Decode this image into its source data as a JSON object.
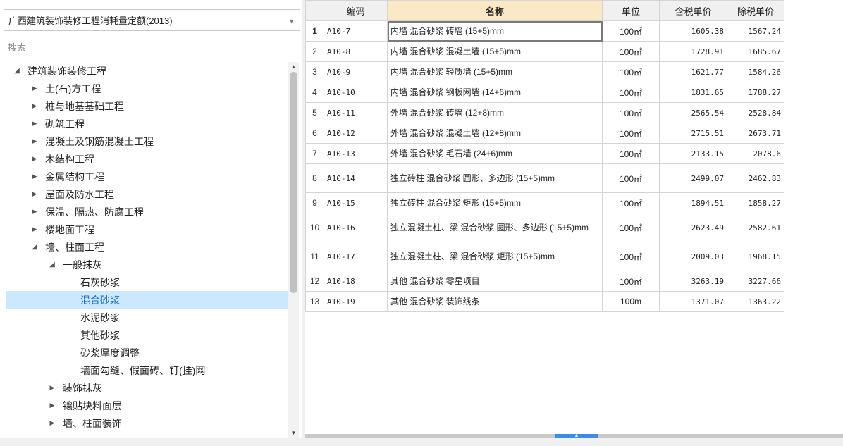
{
  "quota_select": {
    "value": "广西建筑装饰装修工程消耗量定额(2013)"
  },
  "search": {
    "placeholder": "搜索",
    "value": ""
  },
  "tree": [
    {
      "label": "建筑装饰装修工程",
      "level": 0,
      "state": "open"
    },
    {
      "label": "土(石)方工程",
      "level": 1,
      "state": "closed"
    },
    {
      "label": "桩与地基基础工程",
      "level": 1,
      "state": "closed"
    },
    {
      "label": "砌筑工程",
      "level": 1,
      "state": "closed"
    },
    {
      "label": "混凝土及钢筋混凝土工程",
      "level": 1,
      "state": "closed"
    },
    {
      "label": "木结构工程",
      "level": 1,
      "state": "closed"
    },
    {
      "label": "金属结构工程",
      "level": 1,
      "state": "closed"
    },
    {
      "label": "屋面及防水工程",
      "level": 1,
      "state": "closed"
    },
    {
      "label": "保温、隔热、防腐工程",
      "level": 1,
      "state": "closed"
    },
    {
      "label": "楼地面工程",
      "level": 1,
      "state": "closed"
    },
    {
      "label": "墙、柱面工程",
      "level": 1,
      "state": "open"
    },
    {
      "label": "一般抹灰",
      "level": 2,
      "state": "open"
    },
    {
      "label": "石灰砂浆",
      "level": 3,
      "state": "leaf"
    },
    {
      "label": "混合砂浆",
      "level": 3,
      "state": "leaf",
      "selected": true
    },
    {
      "label": "水泥砂浆",
      "level": 3,
      "state": "leaf"
    },
    {
      "label": "其他砂浆",
      "level": 3,
      "state": "leaf"
    },
    {
      "label": "砂浆厚度调整",
      "level": 3,
      "state": "leaf"
    },
    {
      "label": "墙面勾缝、假面砖、钉(挂)网",
      "level": 3,
      "state": "leaf"
    },
    {
      "label": "装饰抹灰",
      "level": 2,
      "state": "closed"
    },
    {
      "label": "镶贴块料面层",
      "level": 2,
      "state": "closed"
    },
    {
      "label": "墙、柱面装饰",
      "level": 2,
      "state": "closed"
    }
  ],
  "grid": {
    "columns": [
      "",
      "编码",
      "名称",
      "单位",
      "含税单价",
      "除税单价"
    ],
    "rows": [
      {
        "idx": "1",
        "code": "A10-7",
        "name": "内墙 混合砂浆 砖墙 (15+5)mm",
        "unit": "100㎡",
        "tax": "1605.38",
        "notax": "1567.24"
      },
      {
        "idx": "2",
        "code": "A10-8",
        "name": "内墙 混合砂浆 混凝土墙 (15+5)mm",
        "unit": "100㎡",
        "tax": "1728.91",
        "notax": "1685.67"
      },
      {
        "idx": "3",
        "code": "A10-9",
        "name": "内墙 混合砂浆 轻质墙 (15+5)mm",
        "unit": "100㎡",
        "tax": "1621.77",
        "notax": "1584.26"
      },
      {
        "idx": "4",
        "code": "A10-10",
        "name": "内墙 混合砂浆 钢板网墙 (14+6)mm",
        "unit": "100㎡",
        "tax": "1831.65",
        "notax": "1788.27"
      },
      {
        "idx": "5",
        "code": "A10-11",
        "name": "外墙 混合砂浆 砖墙 (12+8)mm",
        "unit": "100㎡",
        "tax": "2565.54",
        "notax": "2528.84"
      },
      {
        "idx": "6",
        "code": "A10-12",
        "name": "外墙 混合砂浆 混凝土墙 (12+8)mm",
        "unit": "100㎡",
        "tax": "2715.51",
        "notax": "2673.71"
      },
      {
        "idx": "7",
        "code": "A10-13",
        "name": "外墙 混合砂浆 毛石墙 (24+6)mm",
        "unit": "100㎡",
        "tax": "2133.15",
        "notax": "2078.6"
      },
      {
        "idx": "8",
        "code": "A10-14",
        "name": "独立砖柱 混合砂浆 圆形、多边形 (15+5)mm",
        "unit": "100㎡",
        "tax": "2499.07",
        "notax": "2462.83"
      },
      {
        "idx": "9",
        "code": "A10-15",
        "name": "独立砖柱 混合砂浆 矩形 (15+5)mm",
        "unit": "100㎡",
        "tax": "1894.51",
        "notax": "1858.27"
      },
      {
        "idx": "10",
        "code": "A10-16",
        "name": "独立混凝土柱、梁 混合砂浆 圆形、多边形 (15+5)mm",
        "unit": "100㎡",
        "tax": "2623.49",
        "notax": "2582.61"
      },
      {
        "idx": "11",
        "code": "A10-17",
        "name": "独立混凝土柱、梁 混合砂浆 矩形 (15+5)mm",
        "unit": "100㎡",
        "tax": "2009.03",
        "notax": "1968.15"
      },
      {
        "idx": "12",
        "code": "A10-18",
        "name": "其他 混合砂浆 零星项目",
        "unit": "100㎡",
        "tax": "3263.19",
        "notax": "3227.66"
      },
      {
        "idx": "13",
        "code": "A10-19",
        "name": "其他 混合砂浆 装饰线条",
        "unit": "100m",
        "tax": "1371.07",
        "notax": "1363.22"
      }
    ]
  },
  "icons": {
    "dropdown": "chevron-down-icon",
    "expanded": "triangle-down-icon",
    "collapsed": "triangle-right-icon"
  }
}
